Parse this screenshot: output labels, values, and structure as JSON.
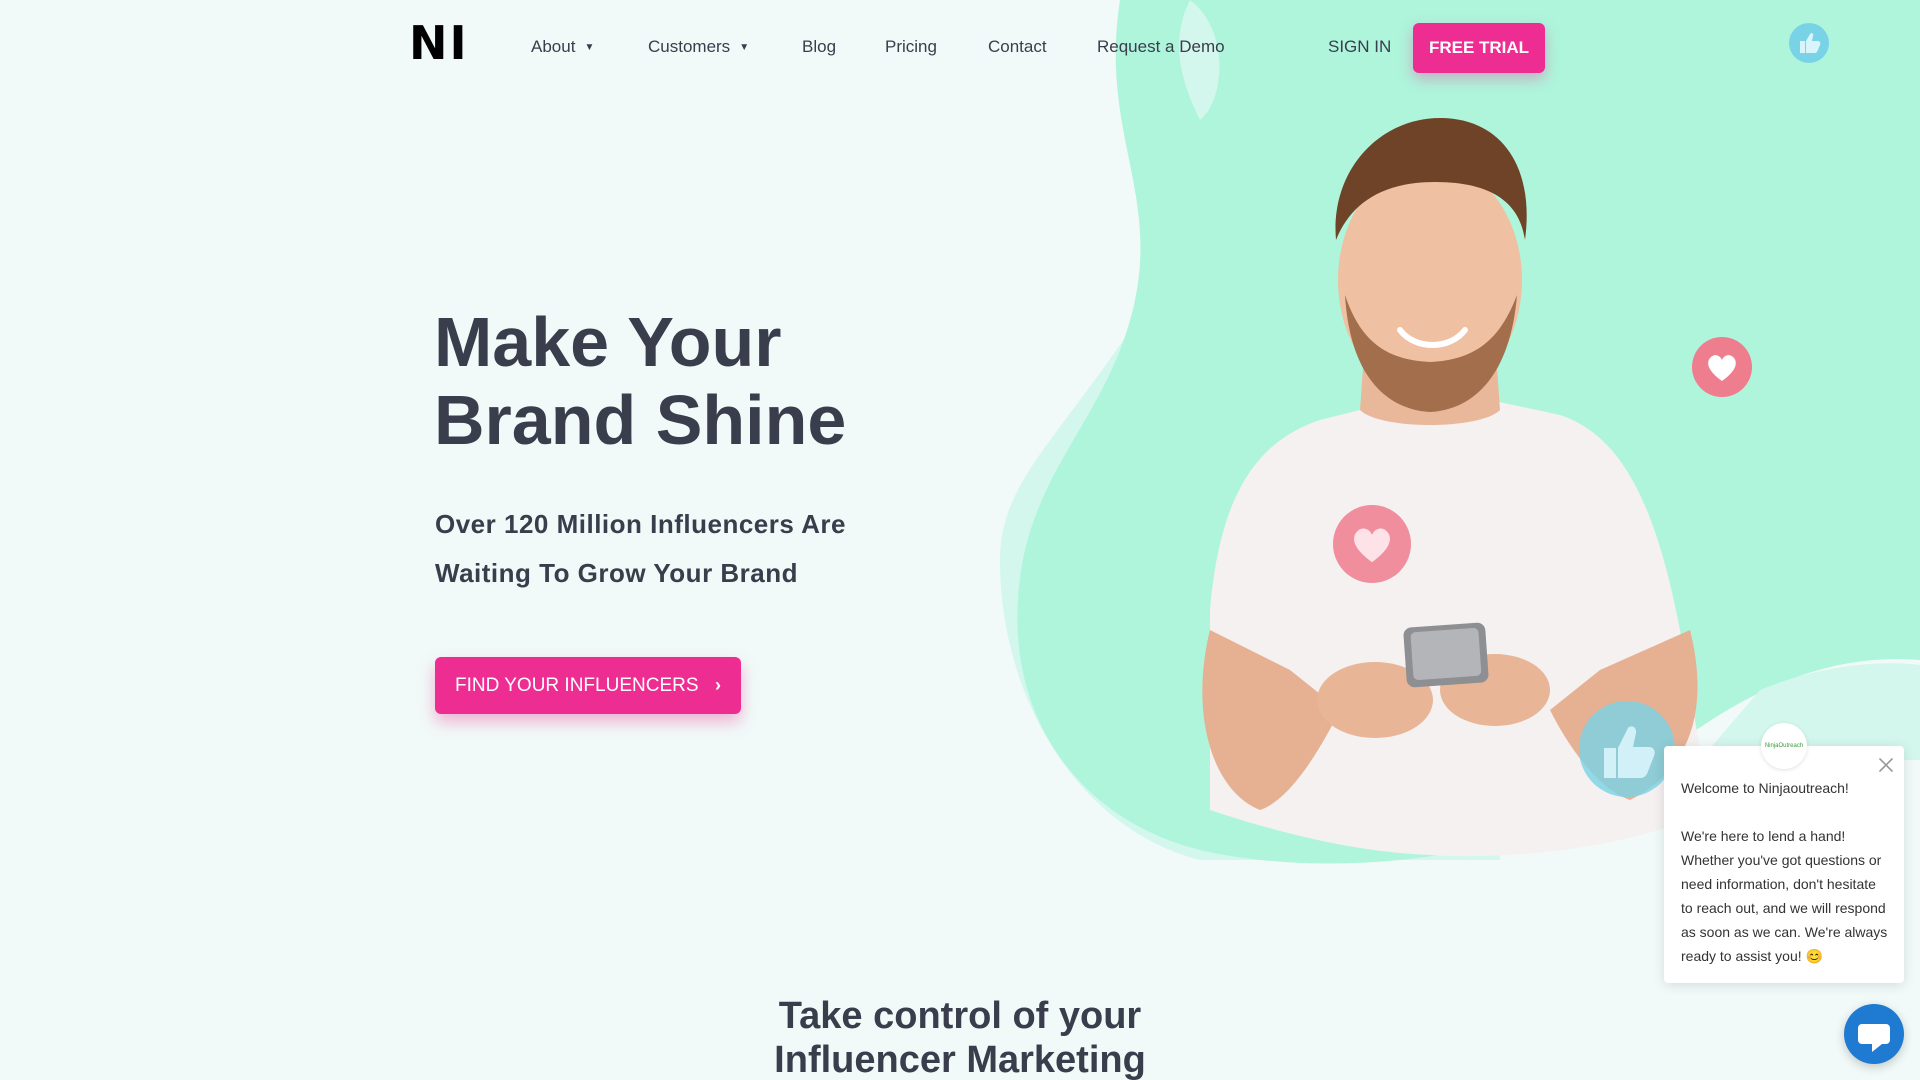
{
  "brand": {
    "logo_text": "NI"
  },
  "nav": {
    "items": [
      {
        "label": "About",
        "has_dropdown": true
      },
      {
        "label": "Customers",
        "has_dropdown": true
      },
      {
        "label": "Blog",
        "has_dropdown": false
      },
      {
        "label": "Pricing",
        "has_dropdown": false
      },
      {
        "label": "Contact",
        "has_dropdown": false
      },
      {
        "label": "Request a Demo",
        "has_dropdown": false
      }
    ],
    "sign_in_label": "SIGN IN",
    "free_trial_label": "FREE TRIAL"
  },
  "hero": {
    "title_line1": "Make Your",
    "title_line2": "Brand Shine",
    "subtitle_line1": "Over 120 Million Influencers Are",
    "subtitle_line2": "Waiting To Grow Your Brand",
    "cta_label": "FIND YOUR INFLUENCERS",
    "cta_icon": "chevron-right-icon"
  },
  "section": {
    "title_line1": "Take control of your",
    "title_line2": "Influencer Marketing"
  },
  "chat": {
    "avatar_text": "NinjaOutreach",
    "greeting": "Welcome to Ninjaoutreach!",
    "message": "We're here to lend a hand! Whether you've got questions or need information, don't hesitate to reach out, and we will respond as soon as we can. We're always ready to assist you! 😊",
    "close_icon": "close-icon",
    "launcher_icon": "chat-bubble-icon"
  },
  "colors": {
    "accent": "#ee2d93",
    "text_dark": "#3a3d4c",
    "page_bg": "#f1faf8",
    "blob_mint": "#aef5dc",
    "blob_light": "#d3f7ec",
    "heart_pink": "#ee7d8e",
    "thumb_blue": "#79d3e6",
    "chat_blue": "#1f7ad1"
  }
}
